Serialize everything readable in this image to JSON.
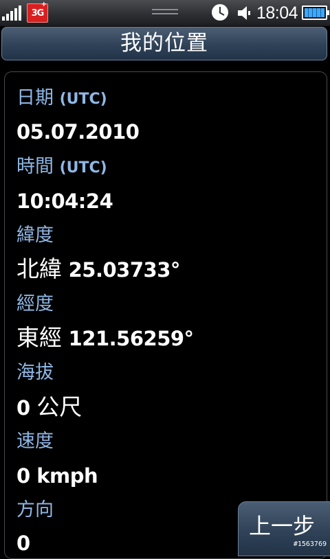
{
  "status_bar": {
    "network_badge": "3G",
    "network_badge_plus": "+",
    "time": "18:04",
    "icons": [
      "signal-icon",
      "3g-badge-icon",
      "alarm-clock-icon",
      "speaker-icon",
      "battery-icon"
    ]
  },
  "header": {
    "title": "我的位置"
  },
  "fields": {
    "date_label": "日期",
    "date_label_sub": "(UTC)",
    "date_value": "05.07.2010",
    "time_label": "時間",
    "time_label_sub": "(UTC)",
    "time_value": "10:04:24",
    "latitude_label": "緯度",
    "latitude_prefix": "北緯",
    "latitude_value": "25.03733°",
    "longitude_label": "經度",
    "longitude_prefix": "東經",
    "longitude_value": "121.56259°",
    "altitude_label": "海拔",
    "altitude_value": "0",
    "altitude_unit": "公尺",
    "speed_label": "速度",
    "speed_value": "0 kmph",
    "direction_label": "方向",
    "direction_value": "0"
  },
  "footer": {
    "back_label": "上一步",
    "watermark": "#1563769"
  },
  "colors": {
    "label": "#8fb8e6",
    "titlebar": "#2f4257",
    "background": "#000000"
  }
}
